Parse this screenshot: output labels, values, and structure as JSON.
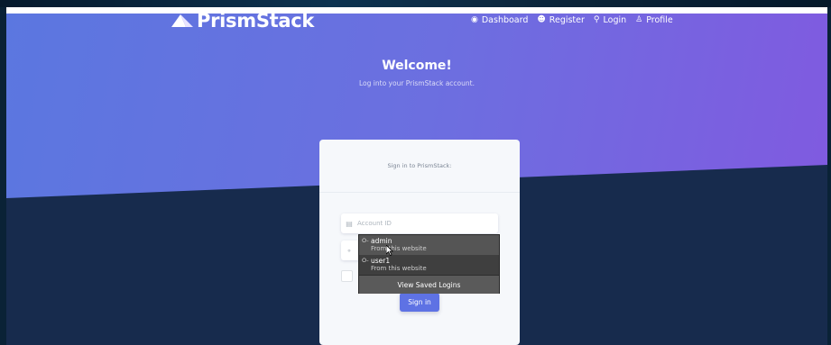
{
  "brand": {
    "name": "PrismStack"
  },
  "nav": {
    "items": [
      {
        "label": "Dashboard",
        "icon": "dashboard-icon"
      },
      {
        "label": "Register",
        "icon": "user-circle-icon"
      },
      {
        "label": "Login",
        "icon": "key-icon"
      },
      {
        "label": "Profile",
        "icon": "person-icon"
      }
    ]
  },
  "hero": {
    "title": "Welcome!",
    "subtitle": "Log into your PrismStack account."
  },
  "login_card": {
    "header": "Sign in to PrismStack:",
    "account_placeholder": "Account ID",
    "password_placeholder": "",
    "submit_label": "Sign in"
  },
  "autofill": {
    "entries": [
      {
        "username": "admin",
        "source": "From this website"
      },
      {
        "username": "user1",
        "source": "From this website"
      }
    ],
    "view_saved": "View Saved Logins"
  },
  "colors": {
    "hero_start": "#5b77e0",
    "hero_end": "#8159e0",
    "dark_section": "#172b4d",
    "primary_button": "#5e72e4",
    "card": "#f6f8fb"
  }
}
